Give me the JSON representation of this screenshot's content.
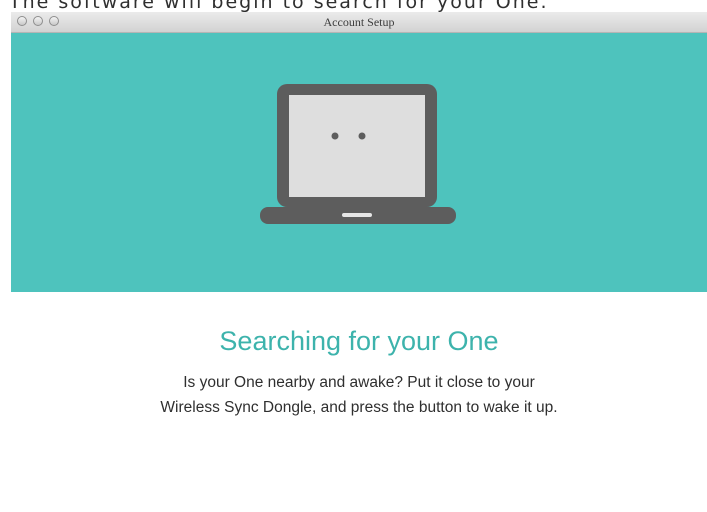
{
  "caption": "The  software will begin to search for your One.",
  "window": {
    "title": "Account Setup"
  },
  "hero": {
    "background_color": "#4ec3bd",
    "icon": "laptop-icon"
  },
  "content": {
    "heading": "Searching for your One",
    "body_line_1": "Is your One nearby and awake? Put it close to your",
    "body_line_2": "Wireless Sync Dongle, and press the button to wake it up."
  },
  "colors": {
    "accent": "#3db3ac",
    "hero": "#4ec3bd",
    "laptop_dark": "#5d5d5d",
    "laptop_screen": "#dedede"
  }
}
